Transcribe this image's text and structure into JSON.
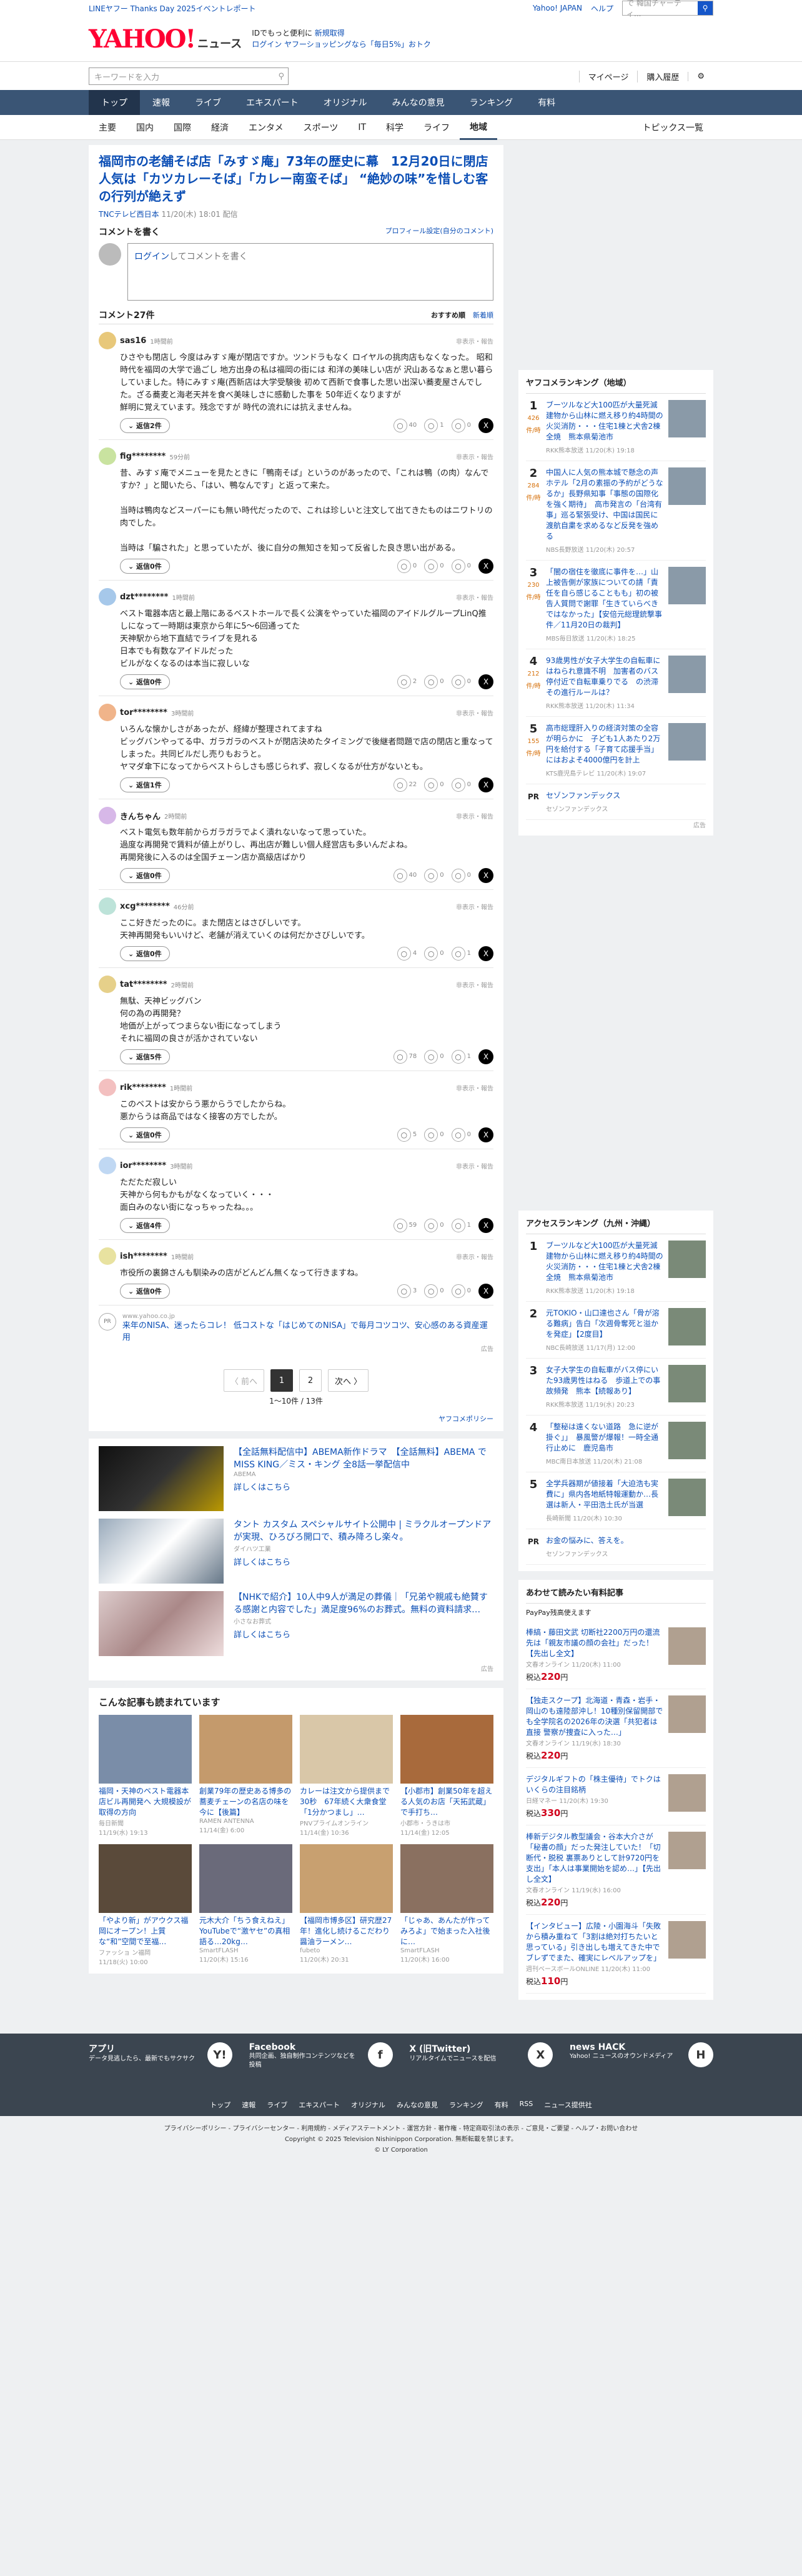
{
  "topbar": {
    "promo": "LINEヤフー Thanks Day 2025イベントレポート",
    "yj": "Yahoo! JAPAN",
    "help": "ヘルプ",
    "search_ph": "ウェブ検索",
    "search_ph2": "で 韓国チャーティ..."
  },
  "header": {
    "logo": "YAHOO!",
    "logo_sub": "ニュース",
    "promo1": "IDでもっと便利に",
    "promo1b": "新規取得",
    "promo2": "ログイン",
    "promo2b": "ヤフーショッピングなら「毎日5%」おトク"
  },
  "search": {
    "placeholder": "キーワードを入力",
    "mypage": "マイページ",
    "purchase": "購入履歴"
  },
  "gnav": [
    "トップ",
    "速報",
    "ライブ",
    "エキスパート",
    "オリジナル",
    "みんなの意見",
    "ランキング",
    "有料"
  ],
  "snav": [
    "主要",
    "国内",
    "国際",
    "経済",
    "エンタメ",
    "スポーツ",
    "IT",
    "科学",
    "ライフ",
    "地域"
  ],
  "snav_right": "トピックス一覧",
  "article": {
    "title": "福岡市の老舗そば店「みすゞ庵」73年の歴史に幕　12月20日に閉店　人気は「カツカレーそば」「カレー南蛮そば」 “絶妙の味”を惜しむ客の行列が絶えず",
    "source": "TNCテレビ西日本",
    "date": "11/20(木) 18:01 配信"
  },
  "comment_write": {
    "head": "コメントを書く",
    "profile": "プロフィール設定(自分のコメント)",
    "login": "ログイン",
    "box": "してコメントを書く"
  },
  "comments_head": {
    "label": "コメント27件",
    "sort1": "おすすめ順",
    "sort2": "新着順"
  },
  "comments": [
    {
      "name": "sas16",
      "time": "1時間前",
      "report": "非表示・報告",
      "text": "ひさやも閉店し 今度はみすゞ庵が閉店ですか。ツンドラもなく ロイヤルの挑肉店もなくなった。 昭和時代を福岡の大学で過ごし 地方出身の私は福岡の街には 和洋の美味しい店が 沢山あるなぁと思い暮らしていました。特にみすゞ庵(西新店は大学受験後 初めて西新で食事した思い出深い蕎麦屋さんでした。ざる蕎麦と海老天丼を食べ美味しさに感動した事を 50年近くなりますが\n鮮明に覚えています。残念ですが 時代の流れには抗えませんね。",
      "reply": "返信2件",
      "like": "40",
      "nar": "1",
      "un": "0"
    },
    {
      "name": "fig********",
      "time": "59分前",
      "report": "非表示・報告",
      "text": "昔、みすゞ庵でメニューを見たときに「鴨南そば」というのがあったので、「これは鴨（の肉）なんですか？」と聞いたら、「はい、鴨なんです」と返って来た。\n\n当時は鴨肉などスーパーにも無い時代だったので、これは珍しいと注文して出てきたものはニワトリの肉でした。\n\n当時は「騙された」と思っていたが、後に自分の無知さを知って反省した良き思い出がある。",
      "reply": "返信0件",
      "like": "0",
      "nar": "0",
      "un": "0"
    },
    {
      "name": "dzt********",
      "time": "1時間前",
      "report": "非表示・報告",
      "text": "ベスト電器本店と最上階にあるベストホールで長く公演をやっていた福岡のアイドルグループLinQ推しになって一時期は東京から年に5〜6回通ってた\n天神駅から地下直結でライブを見れる\n日本でも有数なアイドルだった\nビルがなくなるのは本当に寂しいな",
      "reply": "返信0件",
      "like": "2",
      "nar": "0",
      "un": "0"
    },
    {
      "name": "tor********",
      "time": "3時間前",
      "report": "非表示・報告",
      "text": "いろんな懐かしさがあったが、経緯が整理されてますね\nビッグバンやってる中、ガラガラのベストが閉店決めたタイミングで後継者問題で店の閉店と重なってしまった。共同ビルだし売りもおうと。\nヤマダ傘下になってからベストらしさも感じられず、寂しくなるが仕方がないとも。",
      "reply": "返信1件",
      "like": "22",
      "nar": "0",
      "un": "0"
    },
    {
      "name": "きんちゃん",
      "time": "2時間前",
      "report": "非表示・報告",
      "text": "ベスト電気も数年前からガラガラでよく潰れないなって思っていた。\n過度な再開発で賃料が値上がりし、再出店が難しい個人経営店も多いんだよね。\n再開発後に入るのは全国チェーン店か高級店ばかり",
      "reply": "返信0件",
      "like": "40",
      "nar": "0",
      "un": "0"
    },
    {
      "name": "xcg********",
      "time": "46分前",
      "report": "非表示・報告",
      "text": "ここ好きだったのに。また閉店とはさびしいです。\n天神再開発もいいけど、老舗が消えていくのは何だかさびしいです。",
      "reply": "返信0件",
      "like": "4",
      "nar": "0",
      "un": "1"
    },
    {
      "name": "tat********",
      "time": "2時間前",
      "report": "非表示・報告",
      "text": "無駄、天神ビッグバン\n何の為の再開発？\n地価が上がってつまらない街になってしまう\nそれに福岡の良さが活かされていない",
      "reply": "返信5件",
      "like": "78",
      "nar": "0",
      "un": "1"
    },
    {
      "name": "rik********",
      "time": "1時間前",
      "report": "非表示・報告",
      "text": "このベストは安からう悪からうでしたからね。\n悪からうは商品ではなく接客の方でしたが。",
      "reply": "返信0件",
      "like": "5",
      "nar": "0",
      "un": "0"
    },
    {
      "name": "ior********",
      "time": "3時間前",
      "report": "非表示・報告",
      "text": "ただただ寂しい\n天神から何もかもがなくなっていく・・・\n面白みのない街になっちゃったね。。。",
      "reply": "返信4件",
      "like": "59",
      "nar": "0",
      "un": "1"
    },
    {
      "name": "ish********",
      "time": "1時間前",
      "report": "非表示・報告",
      "text": "市役所の裏錦さんも馴染みの店がどんどん無くなって行きますね。",
      "reply": "返信0件",
      "like": "3",
      "nar": "0",
      "un": "0"
    }
  ],
  "inline_ad": {
    "src": "www.yahoo.co.jp",
    "text": "来年のNISA、迷ったらコレ！ 低コストな「はじめてのNISA」で毎月コツコツ、安心感のある資産運用",
    "label": "広告"
  },
  "pager": {
    "prev": "〈 前へ",
    "p1": "1",
    "p2": "2",
    "next": "次へ 〉",
    "count": "1〜10件 / 13件"
  },
  "ads": {
    "policy": "ヤフコメポリシー",
    "items": [
      {
        "title": "【全話無料配信中】ABEMA新作ドラマ　【全話無料】ABEMA で MISS KING／ミス・キング 全8話一挙配信中",
        "sponsor": "ABEMA",
        "more": "詳しくはこちら"
      },
      {
        "title": "タント カスタム スペシャルサイト公開中 | ミラクルオープンドアが実現、ひろびろ開口で、積み降ろし楽々。",
        "sponsor": "ダイハツ工業",
        "more": "詳しくはこちら"
      },
      {
        "title": "【NHKで紹介】10人中9人が満足の葬儀｜「兄弟や親戚も絶賛する感謝と内容でした」満足度96%のお葬式。無料の資料請求…",
        "sponsor": "小さなお葬式",
        "more": "詳しくはこちら"
      }
    ],
    "label": "広告"
  },
  "recommend": {
    "head": "こんな記事も読まれています",
    "items": [
      {
        "title": "福岡・天神のベスト電器本店ビル再開発へ 大規模設が取得の方向",
        "src": "毎日新聞",
        "date": "11/19(水) 19:13"
      },
      {
        "title": "創業79年の歴史ある博多の蕎麦チェーンの名店の味を今に【後篇】",
        "src": "RAMEN ANTENNA",
        "date": "11/14(金) 6:00"
      },
      {
        "title": "カレーは注文から提供まで30秒　67年続く大衆食堂「1分かつまし」…",
        "src": "PNVプライムオンライン",
        "date": "11/14(金) 10:36"
      },
      {
        "title": "【小郡市】創業50年を超える人気のお店「天拓武蔵」で手打ち…",
        "src": "小郡市・うきは市",
        "date": "11/14(金) 12:05"
      },
      {
        "title": "「やより新」がアウクス福岡にオープン！上質な“和”空間で至福…",
        "src": "ファッショ ン福岡",
        "date": "11/18(火) 10:00"
      },
      {
        "title": "元木大介「ちう食えねえ」YouTubeで“激ヤセ”の真相語る…20kg…",
        "src": "SmartFLASH",
        "date": "11/20(木) 15:16"
      },
      {
        "title": "【福岡市博多区】研究歴27年！進化し続けるこだわり醤油ラーメン…",
        "src": "fubeto",
        "date": "11/20(木) 20:31"
      },
      {
        "title": "「じゃあ、あんたが作ってみろよ」で始まった入社後に…",
        "src": "SmartFLASH",
        "date": "11/20(木) 16:00"
      }
    ]
  },
  "ranking": {
    "head": "ヤフコメランキング（地域）",
    "items": [
      {
        "rank": "1",
        "count": "426",
        "unit": "件/時",
        "title": "ブーツルなど大100匹が大量死滅　建物から山林に燃え移り約4時間の火災消防・・・住宅1棟と犬舎2棟全焼　熊本県菊池市",
        "src": "RKK熊本放送",
        "date": "11/20(木) 19:18"
      },
      {
        "rank": "2",
        "count": "284",
        "unit": "件/時",
        "title": "中国人に人気の熊本城で懸念の声　ホテル「2月の素振の予約がどうなるか」長野県知事「事態の国際化を強く期待」　高市発言の「台湾有事」巡る緊張受け、中国は国民に渡航自粛を求めるなど反発を強める",
        "src": "NBS長野放送",
        "date": "11/20(木) 20:57"
      },
      {
        "rank": "3",
        "count": "230",
        "unit": "件/時",
        "title": "「闇の宿住を徹底に事件を…」山上被告側が家族についての請「責任を自ら感じることもも」初の被告人質問で謝罪「生きていらべきではなかった」【安倍元総理銃撃事件／11月20日の裁判】",
        "src": "MBS毎日放送",
        "date": "11/20(木) 18:25"
      },
      {
        "rank": "4",
        "count": "212",
        "unit": "件/時",
        "title": "93歳男性が女子大学生の自転車にはねられ意識不明　加害者のバス停付近で自転車乗りでる　の渋滞 その進行ルールは？",
        "src": "RKK熊本放送",
        "date": "11/20(木) 11:34"
      },
      {
        "rank": "5",
        "count": "155",
        "unit": "件/時",
        "title": "高市総理肝入りの経済対策の全容が明らかに　子ども1人あたり2万円を給付する「子育て応援手当」にはおよそ4000億円を計上",
        "src": "KTS鹿児島テレビ",
        "date": "11/20(木) 19:07"
      }
    ],
    "pr_title": "セゾンファンデックス",
    "pr_sub": "セゾンファンデックス",
    "label": "広告"
  },
  "access": {
    "head": "アクセスランキング（九州・沖縄）",
    "items": [
      {
        "rank": "1",
        "title": "ブーツルなど大100匹が大量死滅　建物から山林に燃え移り約4時間の火災消防・・・住宅1棟と犬舎2棟全焼　熊本県菊池市",
        "src": "RKK熊本放送",
        "date": "11/20(木) 19:18"
      },
      {
        "rank": "2",
        "title": "元TOKIO・山口達也さん「骨が溶る難病」告白「次週骨奪死と溢かを発症」【2度目】",
        "src": "NBC長崎放送",
        "date": "11/17(月) 12:00"
      },
      {
        "rank": "3",
        "title": "女子大学生の自転車がバス停にいた93歳男性はねる　歩道上での事故頻発　熊本【続報あり】",
        "src": "RKK熊本放送",
        "date": "11/19(水) 20:23"
      },
      {
        "rank": "4",
        "title": "「整秘は遠くない道路　急に逆が掛ぐ」」　暴風警が爆報！一時全通行止めに　鹿児島市",
        "src": "MBC南日本放送",
        "date": "11/20(木) 21:08"
      },
      {
        "rank": "5",
        "title": "全学兵器期が値接着「大迫浩も実費に」県内各地紙特報運動か…長選は新人・平田浩土氏が当選",
        "src": "長崎新聞",
        "date": "11/20(木) 10:30"
      }
    ],
    "pr_title": "お金の悩みに、答えを。",
    "pr_sub": "セゾンファンデックス"
  },
  "paid": {
    "head": "あわせて読みたい有料記事",
    "brand": "PayPay残高使えます",
    "items": [
      {
        "title": "棒縞・藤田文武 切断社2200万円の還流先は「親友市議の顔の会社」だった！【先出し全文】",
        "src": "文春オンライン",
        "date": "11/20(木) 11:00",
        "price": "220"
      },
      {
        "title": "【独走スクープ】北海道・青森・岩手・岡山のも遠陸部沖し！10種別保留開部でも全学院名の2026年の決選「共犯者は直接 警察が捜査に入った…」",
        "src": "文春オンライン",
        "date": "11/19(水) 18:30",
        "price": "220"
      },
      {
        "title": "デジタルギフトの「株主優待」でトクはいくらの注目銘柄",
        "src": "日経マネー",
        "date": "11/20(木) 19:30",
        "price": "330"
      },
      {
        "title": "棒新デジタル教型議会・谷本大介さが「秘書の顔」だった発注していた！「切断代・脱税 裏票ありとして計9720円を支出」「本人は事業開始を認め…」【先出し全文】",
        "src": "文春オンライン",
        "date": "11/19(水) 16:00",
        "price": "220"
      },
      {
        "title": "【インタビュー】広陵・小園海斗「失敗から積み重ねて「3割は絶対打ちたいと思っている」引き出しも増えてきた中でブレずでまた、確実にレベルアップを」",
        "src": "週刊ベースボールONLINE",
        "date": "11/20(木) 11:00",
        "price": "110"
      }
    ],
    "yen_pre": "税込",
    "yen_post": "円"
  },
  "footer": {
    "cols": [
      {
        "title": "アプリ",
        "desc": "データ見逃したら、最新でもサクサク",
        "icon": "Y!"
      },
      {
        "title": "Facebook",
        "desc": "共同企画、独自制作コンテンツなどを投稿",
        "icon": "f"
      },
      {
        "title": "X (旧Twitter)",
        "desc": "リアルタイムでニュースを配信",
        "icon": "X"
      },
      {
        "title": "news HACK",
        "desc": "Yahoo! ニュースのオウンドメディア",
        "icon": "H"
      }
    ],
    "nav": [
      "トップ",
      "速報",
      "ライブ",
      "エキスパート",
      "オリジナル",
      "みんなの意見",
      "ランキング",
      "有料",
      "RSS",
      "ニュース提供社"
    ],
    "links": "プライバシーポリシー - プライバシーセンター - 利用規約 - メディアステートメント - 運営方針 - 著作権 - 特定商取引法の表示 - ご意見・ご要望 - ヘルプ・お問い合わせ",
    "copy1": "Copyright © 2025 Television Nishinippon Corporation. 無断転載を禁じます。",
    "copy2": "© LY Corporation"
  }
}
